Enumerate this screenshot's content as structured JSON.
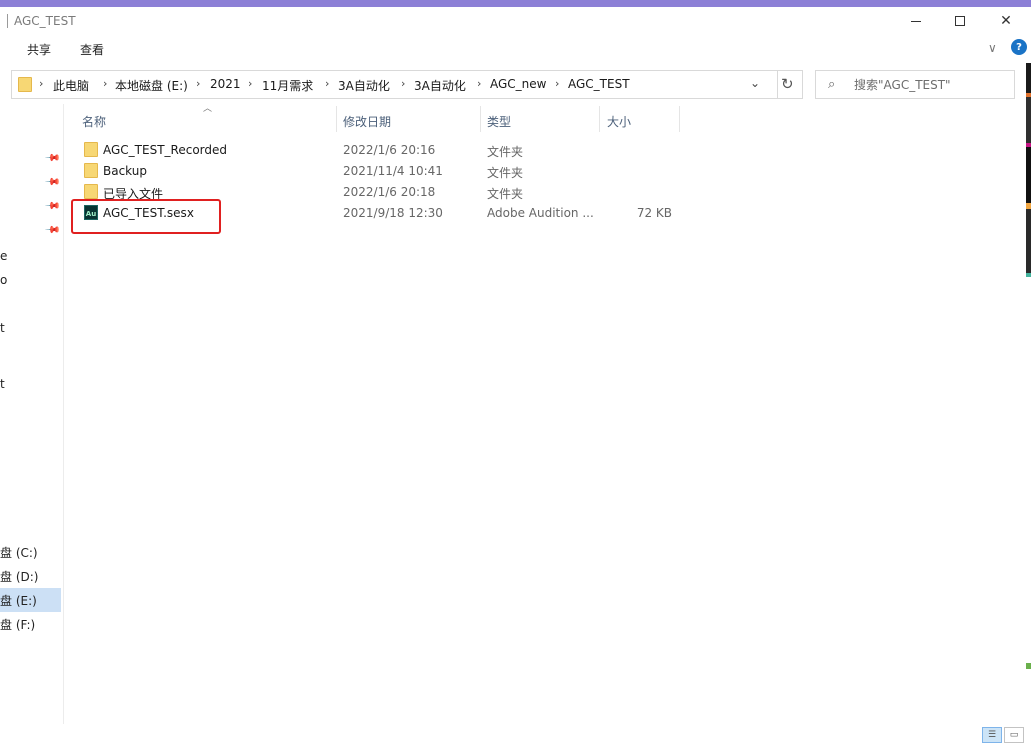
{
  "window": {
    "title": "AGC_TEST"
  },
  "ribbon": {
    "tabs": [
      "共享",
      "查看"
    ]
  },
  "address_bar": {
    "crumbs": [
      "此电脑",
      "本地磁盘 (E:)",
      "2021",
      "11月需求",
      "3A自动化",
      "3A自动化",
      "AGC_new",
      "AGC_TEST"
    ]
  },
  "search": {
    "placeholder": "搜索\"AGC_TEST\""
  },
  "nav_pane": {
    "fragments": [
      "e",
      "o",
      "t",
      "t"
    ],
    "drives": [
      "盘 (C:)",
      "盘 (D:)",
      "盘 (E:)",
      "盘 (F:)"
    ],
    "selected_drive": "盘 (E:)"
  },
  "columns": {
    "name": "名称",
    "date": "修改日期",
    "type": "类型",
    "size": "大小"
  },
  "files": [
    {
      "name": "AGC_TEST_Recorded",
      "date": "2022/1/6 20:16",
      "type": "文件夹",
      "size": "",
      "icon": "folder-icon"
    },
    {
      "name": "Backup",
      "date": "2021/11/4 10:41",
      "type": "文件夹",
      "size": "",
      "icon": "folder-icon"
    },
    {
      "name": "已导入文件",
      "date": "2022/1/6 20:18",
      "type": "文件夹",
      "size": "",
      "icon": "folder-icon"
    },
    {
      "name": "AGC_TEST.sesx",
      "date": "2021/9/18 12:30",
      "type": "Adobe Audition ...",
      "size": "72 KB",
      "icon": "adobe-audition-icon"
    }
  ],
  "colors": {
    "selection": "#cce0f5",
    "highlight_box": "#e02020",
    "folder": "#f7d774"
  }
}
